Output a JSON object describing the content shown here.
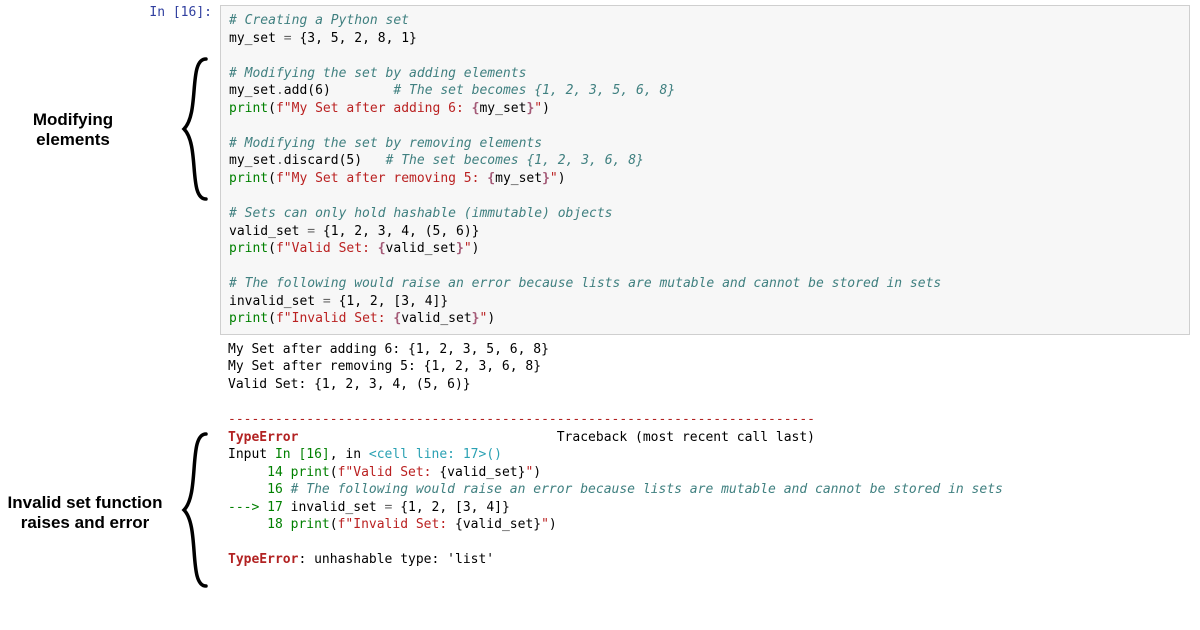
{
  "prompt": "In [16]:",
  "annotations": {
    "modify": "Modifying elements",
    "invalid": "Invalid set function raises and error"
  },
  "code": {
    "l1": "# Creating a Python set",
    "l2a": "my_set ",
    "l2op": "=",
    "l2b": " {",
    "l2n1": "3",
    "l2c": ", ",
    "l2n2": "5",
    "l2d": ", ",
    "l2n3": "2",
    "l2e": ", ",
    "l2n4": "8",
    "l2f": ", ",
    "l2n5": "1",
    "l2g": "}",
    "l4": "# Modifying the set by adding elements",
    "l5a": "my_set",
    "l5dot": ".",
    "l5m": "add",
    "l5p": "(",
    "l5n": "6",
    "l5q": ")        ",
    "l5c": "# The set becomes {1, 2, 3, 5, 6, 8}",
    "l6p": "print",
    "l6a": "(",
    "l6f": "f",
    "l6s1": "\"My Set after adding 6: ",
    "l6b1": "{",
    "l6v": "my_set",
    "l6b2": "}",
    "l6s2": "\"",
    "l6z": ")",
    "l8": "# Modifying the set by removing elements",
    "l9a": "my_set",
    "l9dot": ".",
    "l9m": "discard",
    "l9p": "(",
    "l9n": "5",
    "l9q": ")   ",
    "l9c": "# The set becomes {1, 2, 3, 6, 8}",
    "l10p": "print",
    "l10a": "(",
    "l10f": "f",
    "l10s1": "\"My Set after removing 5: ",
    "l10b1": "{",
    "l10v": "my_set",
    "l10b2": "}",
    "l10s2": "\"",
    "l10z": ")",
    "l12": "# Sets can only hold hashable (immutable) objects",
    "l13a": "valid_set ",
    "l13op": "=",
    "l13b": " {",
    "l13n1": "1",
    "l13c": ", ",
    "l13n2": "2",
    "l13d": ", ",
    "l13n3": "3",
    "l13e": ", ",
    "l13n4": "4",
    "l13f": ", (",
    "l13n5": "5",
    "l13g": ", ",
    "l13n6": "6",
    "l13h": ")}",
    "l14p": "print",
    "l14a": "(",
    "l14f": "f",
    "l14s1": "\"Valid Set: ",
    "l14b1": "{",
    "l14v": "valid_set",
    "l14b2": "}",
    "l14s2": "\"",
    "l14z": ")",
    "l16": "# The following would raise an error because lists are mutable and cannot be stored in sets",
    "l17a": "invalid_set ",
    "l17op": "=",
    "l17b": " {",
    "l17n1": "1",
    "l17c": ", ",
    "l17n2": "2",
    "l17d": ", [",
    "l17n3": "3",
    "l17e": ", ",
    "l17n4": "4",
    "l17f": "]}",
    "l18p": "print",
    "l18a": "(",
    "l18f": "f",
    "l18s1": "\"Invalid Set: ",
    "l18b1": "{",
    "l18v": "valid_set",
    "l18b2": "}",
    "l18s2": "\"",
    "l18z": ")"
  },
  "output": {
    "o1": "My Set after adding 6: {1, 2, 3, 5, 6, 8}",
    "o2": "My Set after removing 5: {1, 2, 3, 6, 8}",
    "o3": "Valid Set: {1, 2, 3, 4, (5, 6)}",
    "dash": "---------------------------------------------------------------------------",
    "err1": "TypeError",
    "err1b": "                                 Traceback (most recent call last)",
    "in1": "Input ",
    "in2": "In [16]",
    "in3": ", in ",
    "in4": "<cell line: 17>",
    "in5": "()",
    "t14a": "     14 ",
    "t14b": "print",
    "t14c": "(",
    "t14d": "f\"Valid Set: ",
    "t14e": "{valid_set}",
    "t14f": "\"",
    "t14g": ")",
    "t16a": "     16 ",
    "t16b": "# The following would raise an error because lists are mutable and cannot be stored in sets",
    "t17a": "---> ",
    "t17b": "17 ",
    "t17c": "invalid_set ",
    "t17d": "=",
    "t17e": " {",
    "t17f": "1",
    "t17g": ", ",
    "t17h": "2",
    "t17i": ", [",
    "t17j": "3",
    "t17k": ", ",
    "t17l": "4",
    "t17m": "]}",
    "t18a": "     18 ",
    "t18b": "print",
    "t18c": "(",
    "t18d": "f\"Invalid Set: ",
    "t18e": "{valid_set}",
    "t18f": "\"",
    "t18g": ")",
    "finalA": "TypeError",
    "finalB": ": unhashable type: 'list'"
  }
}
